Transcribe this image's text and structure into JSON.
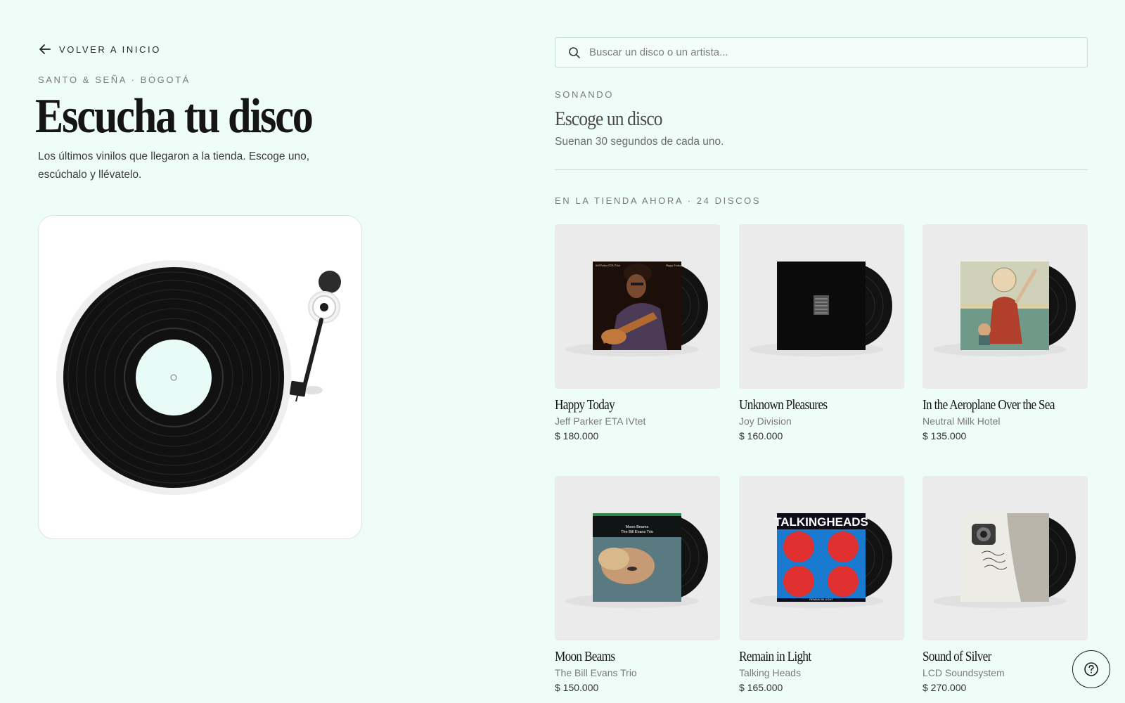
{
  "nav": {
    "back_label": "VOLVER A INICIO"
  },
  "hero": {
    "eyebrow": "SANTO & SEÑA · BOGOTÁ",
    "title": "Escucha tu disco",
    "subtitle": "Los últimos vinilos que llegaron a la tienda. Escoge uno, escúchalo y llévatelo."
  },
  "search": {
    "placeholder": "Buscar un disco o un artista..."
  },
  "now_playing": {
    "label": "SONANDO",
    "title": "Escoge un disco",
    "subtitle": "Suenan 30 segundos de cada uno."
  },
  "store": {
    "label": "EN LA TIENDA AHORA · 24 DISCOS",
    "records": [
      {
        "title": "Happy Today",
        "artist": "Jeff Parker ETA IVtet",
        "price": "$ 180.000",
        "cover": "happy-today-cover"
      },
      {
        "title": "Unknown Pleasures",
        "artist": "Joy Division",
        "price": "$ 160.000",
        "cover": "unknown-pleasures-cover"
      },
      {
        "title": "In the Aeroplane Over the Sea",
        "artist": "Neutral Milk Hotel",
        "price": "$ 135.000",
        "cover": "aeroplane-cover"
      },
      {
        "title": "Moon Beams",
        "artist": "The Bill Evans Trio",
        "price": "$ 150.000",
        "cover": "moon-beams-cover"
      },
      {
        "title": "Remain in Light",
        "artist": "Talking Heads",
        "price": "$ 165.000",
        "cover": "remain-in-light-cover"
      },
      {
        "title": "Sound of Silver",
        "artist": "LCD Soundsystem",
        "price": "$ 270.000",
        "cover": "sound-of-silver-cover"
      }
    ]
  },
  "cover_text": {
    "happy_today_left": "Jeff Parker ETA IVtet",
    "happy_today_right": "Happy Today",
    "moon_beams_line1": "Moon Beams",
    "moon_beams_line2": "The Bill Evans Trio",
    "talking_heads_logo": "TALKINGHEADS",
    "remain_in_light_caption": "REMAIN IN LIGHT"
  },
  "icons": {
    "back": "arrow-left-icon",
    "search": "search-icon",
    "help": "question-circle-icon",
    "turntable": "turntable-illustration"
  },
  "colors": {
    "background": "#effdf9",
    "card_bg": "#ebebeb",
    "text": "#151515",
    "muted": "#7a7a7a"
  }
}
